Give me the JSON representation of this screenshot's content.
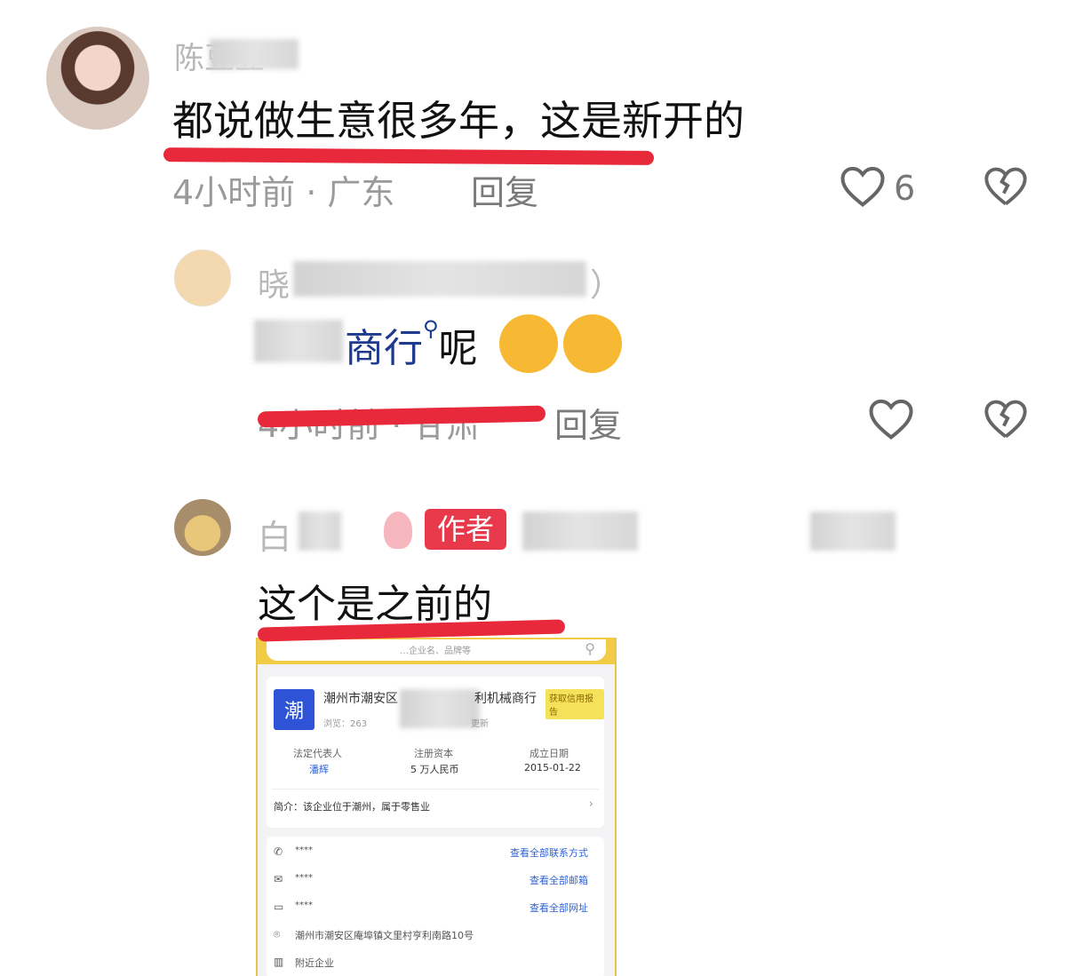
{
  "comments": [
    {
      "name": "陈豆豆",
      "text": "都说做生意很多年，这是新开的",
      "meta": "4小时前 · 广东",
      "reply": "回复",
      "likes": "6"
    },
    {
      "name": "晓",
      "name_tail": "）",
      "text_main": "商行",
      "text_end": "呢",
      "meta": "4小时前 · 甘肃",
      "reply": "回复"
    },
    {
      "name": "白",
      "author_badge": "作者",
      "text": "这个是之前的"
    }
  ],
  "screenshot": {
    "search_placeholder": "…企业名、品牌等",
    "logo_char": "潮",
    "company_name_start": "潮州市潮安区",
    "company_name_end": "利机械商行",
    "report_badge": "获取信用报告",
    "views": "浏览：263",
    "updated": "更新",
    "legal_rep_label": "法定代表人",
    "legal_rep_value": "潘辉",
    "capital_label": "注册资本",
    "capital_value": "5 万人民币",
    "founded_label": "成立日期",
    "founded_value": "2015-01-22",
    "intro": "简介：该企业位于潮州，属于零售业",
    "phone": "****",
    "phone_link": "查看全部联系方式",
    "email": "****",
    "email_link": "查看全部邮箱",
    "website": "****",
    "website_link": "查看全部网址",
    "address": "潮州市潮安区庵埠镇文里村亨利南路10号",
    "nearby": "附近企业"
  },
  "colors": {
    "underline": "#e8283b",
    "author_badge": "#e8394a",
    "link": "#2f63d6",
    "logo": "#2f53d6"
  }
}
